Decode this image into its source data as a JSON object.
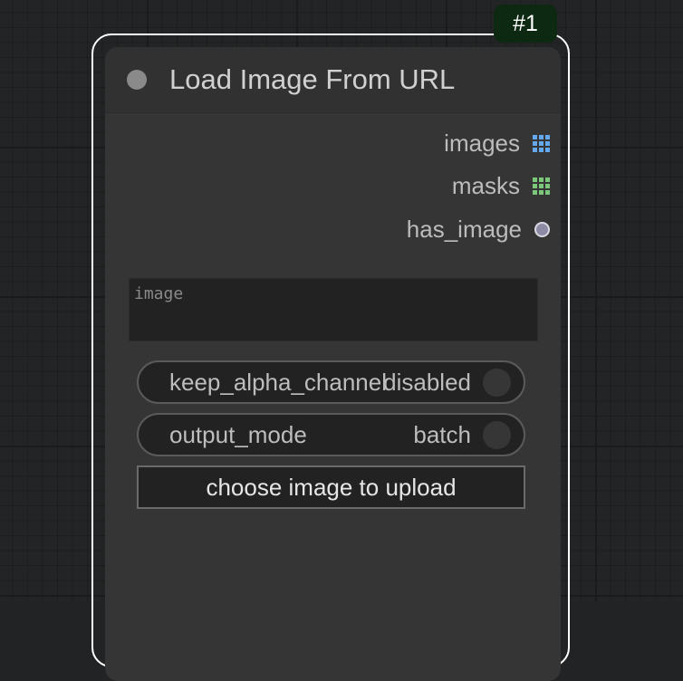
{
  "node": {
    "id_badge": "#1",
    "title": "Load Image From URL",
    "outputs": [
      {
        "label": "images",
        "icon": "grid-icon",
        "color": "#64a8ee"
      },
      {
        "label": "masks",
        "icon": "grid-icon",
        "color": "#7cc87a"
      },
      {
        "label": "has_image",
        "icon": "circle-icon",
        "color": "#8d8aa6"
      }
    ],
    "widgets": {
      "image_input": {
        "value": "",
        "placeholder": "image"
      },
      "keep_alpha_channel": {
        "label": "keep_alpha_channel",
        "value": "disabled"
      },
      "output_mode": {
        "label": "output_mode",
        "value": "batch"
      },
      "upload_button_label": "choose image to upload"
    }
  },
  "colors": {
    "canvas_background": "#232425",
    "node_body": "#353535",
    "node_header": "#313131",
    "badge_background": "#0e2912",
    "selection_outline": "#ffffff"
  }
}
